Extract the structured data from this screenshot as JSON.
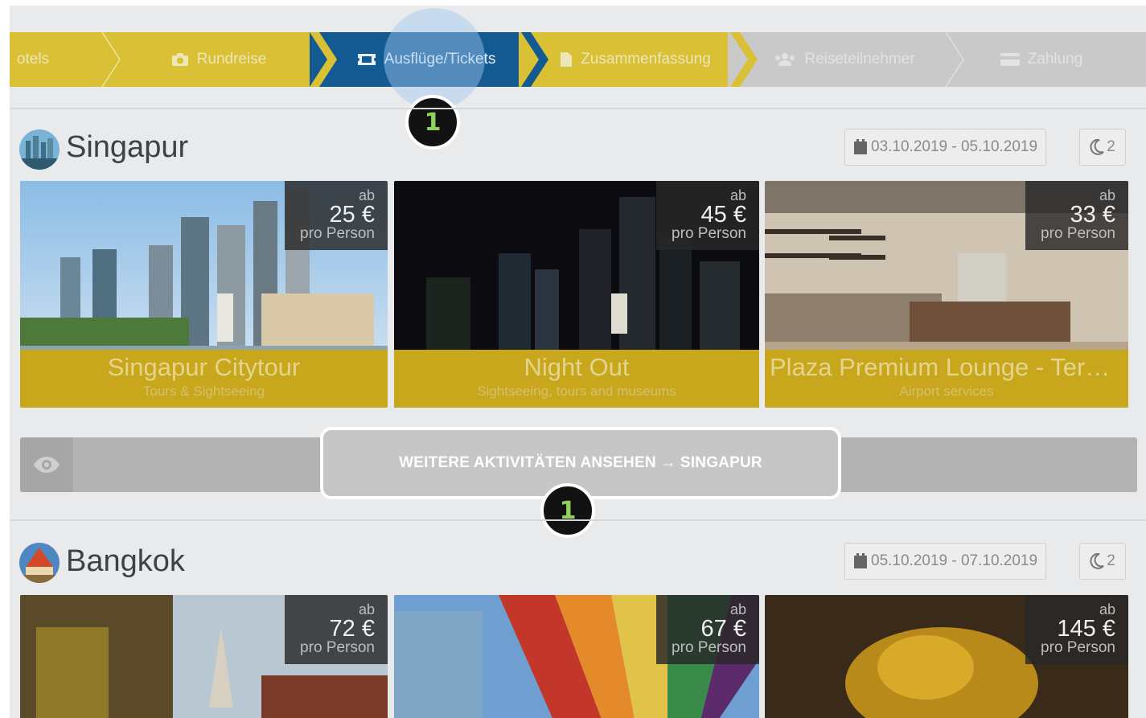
{
  "steps": [
    {
      "label": "otels",
      "icon": "",
      "state": "done"
    },
    {
      "label": "Rundreise",
      "icon": "camera-icon",
      "state": "done"
    },
    {
      "label": "Ausflüge/Tickets",
      "icon": "ticket-icon",
      "state": "active"
    },
    {
      "label": "Zusammenfassung",
      "icon": "document-icon",
      "state": "done"
    },
    {
      "label": "Reiseteilnehmer",
      "icon": "users-icon",
      "state": "pending"
    },
    {
      "label": "Zahlung",
      "icon": "credit-card-icon",
      "state": "pending"
    }
  ],
  "markers": [
    "1",
    "1"
  ],
  "cities": [
    {
      "name": "Singapur",
      "dates": "03.10.2019 - 05.10.2019",
      "nights": "2",
      "activities": [
        {
          "ab": "ab",
          "price": "25 €",
          "per": "pro Person",
          "title": "Singapur Citytour",
          "category": "Tours & Sightseeing"
        },
        {
          "ab": "ab",
          "price": "45 €",
          "per": "pro Person",
          "title": "Night Out",
          "category": "Sightseeing, tours and museums"
        },
        {
          "ab": "ab",
          "price": "33 €",
          "per": "pro Person",
          "title": "Plaza Premium Lounge - Termina...",
          "category": "Airport services"
        }
      ],
      "more_label": "WEITERE AKTIVITÄTEN ANSEHEN → SINGAPUR"
    },
    {
      "name": "Bangkok",
      "dates": "05.10.2019 - 07.10.2019",
      "nights": "2",
      "activities": [
        {
          "ab": "ab",
          "price": "72 €",
          "per": "pro Person"
        },
        {
          "ab": "ab",
          "price": "67 €",
          "per": "pro Person"
        },
        {
          "ab": "ab",
          "price": "145 €",
          "per": "pro Person"
        }
      ]
    }
  ],
  "colors": {
    "step_done": "#d9c035",
    "step_active": "#135a93",
    "step_pending": "#c9c9c9",
    "card_footer": "#c8a71c"
  }
}
